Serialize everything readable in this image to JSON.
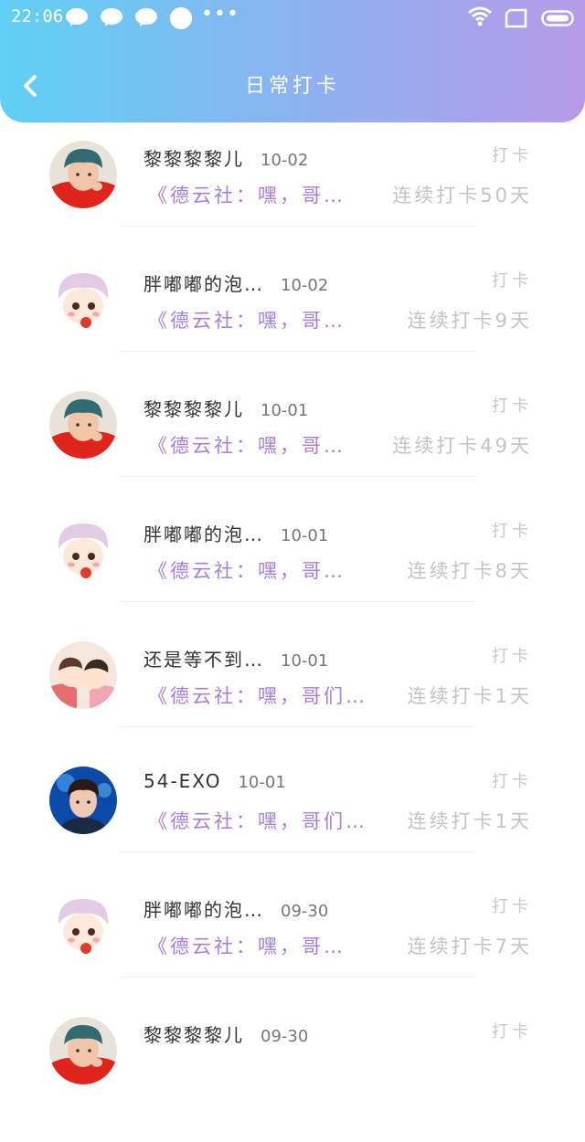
{
  "status_bar": {
    "time": "22:06",
    "more": "•••"
  },
  "header": {
    "title": "日常打卡",
    "colors": {
      "gradient_start": "#5fd0f5",
      "gradient_end": "#b79ae8"
    }
  },
  "rows": [
    {
      "name": "黎黎黎黎儿",
      "date": "10-02",
      "action": "打卡",
      "article": "《德云社：嘿，哥…",
      "streak": "连续打卡50天",
      "avatar": "red-hoodie"
    },
    {
      "name": "胖嘟嘟的泡…",
      "date": "10-02",
      "action": "打卡",
      "article": "《德云社：嘿，哥…",
      "streak": "连续打卡9天",
      "avatar": "cartoon-pink"
    },
    {
      "name": "黎黎黎黎儿",
      "date": "10-01",
      "action": "打卡",
      "article": "《德云社：嘿，哥…",
      "streak": "连续打卡49天",
      "avatar": "red-hoodie"
    },
    {
      "name": "胖嘟嘟的泡…",
      "date": "10-01",
      "action": "打卡",
      "article": "《德云社：嘿，哥…",
      "streak": "连续打卡8天",
      "avatar": "cartoon-pink"
    },
    {
      "name": "还是等不到…",
      "date": "10-01",
      "action": "打卡",
      "article": "《德云社：嘿，哥们…",
      "streak": "连续打卡1天",
      "avatar": "cartoon-couple"
    },
    {
      "name": "54-EXO",
      "date": "10-01",
      "action": "打卡",
      "article": "《德云社：嘿，哥们…",
      "streak": "连续打卡1天",
      "avatar": "blue-portrait"
    },
    {
      "name": "胖嘟嘟的泡…",
      "date": "09-30",
      "action": "打卡",
      "article": "《德云社：嘿，哥…",
      "streak": "连续打卡7天",
      "avatar": "cartoon-pink"
    },
    {
      "name": "黎黎黎黎儿",
      "date": "09-30",
      "action": "打卡",
      "article": "",
      "streak": "",
      "avatar": "red-hoodie"
    }
  ]
}
